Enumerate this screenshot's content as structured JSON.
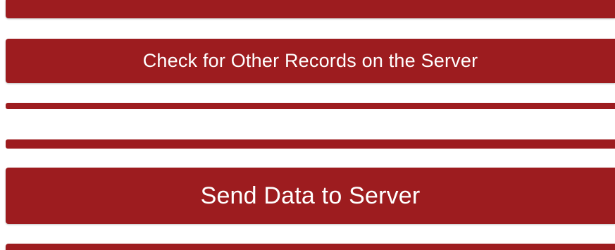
{
  "buttons": {
    "check_other_records": "Check for Other Records on the Server",
    "send_data": "Send Data to Server"
  },
  "colors": {
    "button_background": "#9d1c1f",
    "button_text": "#ffffff",
    "page_background": "#ffffff"
  }
}
